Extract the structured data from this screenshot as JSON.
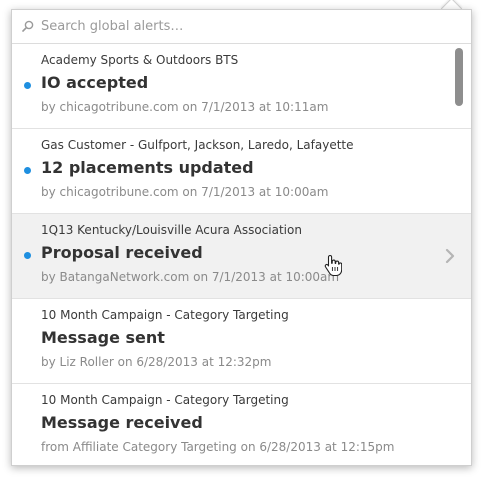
{
  "search": {
    "placeholder": "Search global alerts…"
  },
  "accent_color": "#1e8fe0",
  "alerts": [
    {
      "campaign": "Academy Sports & Outdoors BTS",
      "status": "IO accepted",
      "meta": "by chicagotribune.com on 7/1/2013 at 10:11am",
      "unread": true
    },
    {
      "campaign": "Gas Customer - Gulfport, Jackson, Laredo, Lafayette",
      "status": "12 placements updated",
      "meta": "by chicagotribune.com on 7/1/2013 at 10:00am",
      "unread": true
    },
    {
      "campaign": "1Q13 Kentucky/Louisville Acura Association",
      "status": "Proposal received",
      "meta": "by BatangaNetwork.com on 7/1/2013 at 10:00am",
      "unread": true,
      "hovered": true
    },
    {
      "campaign": "10 Month Campaign - Category Targeting",
      "status": "Message sent",
      "meta": "by Liz Roller on 6/28/2013 at 12:32pm",
      "unread": false
    },
    {
      "campaign": "10 Month Campaign - Category Targeting",
      "status": "Message received",
      "meta": "from Affiliate Category Targeting on 6/28/2013 at 12:15pm",
      "unread": false
    }
  ],
  "icons": {
    "search": "search-icon",
    "chevron": "chevron-right-icon",
    "cursor": "hand-pointer-icon"
  }
}
